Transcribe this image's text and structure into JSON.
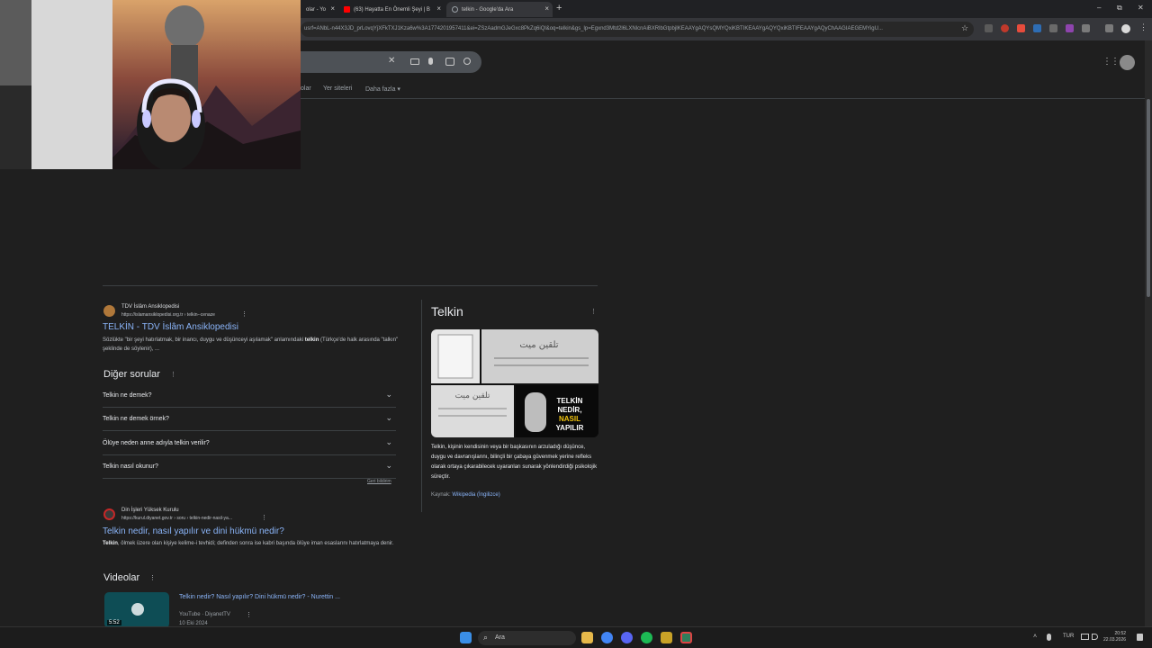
{
  "browser": {
    "tabs": [
      {
        "label": "olar - Yo",
        "favicon_color": "#888888"
      },
      {
        "label": "(63) Hayatta En Önemli Şeyi | B",
        "favicon_color": "#ff0000"
      },
      {
        "label": "telkin - Google'da Ara",
        "favicon_color": "#9aa0a6"
      }
    ],
    "new_tab": "+",
    "close_glyph": "×",
    "window_controls": {
      "minimize": "–",
      "restore": "⧉",
      "close": "✕"
    },
    "url": "usrf=ANbL-n44X3JD_prLovqYjXFkTXJ1Kza6w%3A1774201957411&ei=ZSzAadmGJeGxc8PkZq6iQl&oq=telkin&gs_lp=Egxnd3Mtd2l6LXNlcnAiBXRlbGtpbjIKEAAYgAQYsQMYQxiKBTIKEAAYgAQYQxiKBTIFEAAYgAQyChAAGIAEGEMYigU...",
    "star": "☆",
    "menu": "⋮"
  },
  "google": {
    "clear": "✕",
    "nav_tabs": {
      "partial": "olar",
      "places": "Yer siteleri",
      "more": "Daha fazla"
    },
    "more_caret": "▾",
    "apps_glyph": "⋮⋮⋮"
  },
  "results": [
    {
      "source": "TDV İslâm Ansiklopedisi",
      "url": "https://islamansiklopedisi.org.tr › telkin--cenaze",
      "title": "TELKİN - TDV İslâm Ansiklopedisi",
      "snippet_pre": "Sözlükte \"bir şeyi hatırlatmak, bir inancı, duygu ve düşünceyi aşılamak\" anlamındaki ",
      "snippet_bold": "telkin",
      "snippet_post": " (Türkçe'de halk arasında \"talkın\" şeklinde de söylenir), ...",
      "favicon_color": "#b0783a"
    },
    {
      "source": "Din İşleri Yüksek Kurulu",
      "url": "https://kurul.diyanet.gov.tr › soru › telkin-nedir-nasil-ya...",
      "title": "Telkin nedir, nasıl yapılır ve dini hükmü nedir?",
      "snippet_bold": "Telkin",
      "snippet_post": ", ölmek üzere olan kişiye kelime-i tevhidi; definden sonra ise kabri başında ölüye iman esaslarını hatırlatmaya denir.",
      "favicon_color": "#c62828"
    }
  ],
  "paa": {
    "heading": "Diğer sorular",
    "expand_glyph": "⌄",
    "questions": [
      "Telkin ne demek?",
      "Telkin ne demek örnek?",
      "Ölüye neden anne adıyla telkin verilir?",
      "Telkin nasıl okunur?"
    ],
    "feedback": "Geri bildirim"
  },
  "kp": {
    "title": "Telkin",
    "description": "Telkin, kişinin kendisinin veya bir başkasının arzuladığı düşünce, duygu ve davranışlarını, bilinçli bir çabaya güvenmek yerine refleks olarak ortaya çıkarabilecek uyaranları sunarak yönlendirdiği psikolojik süreçtir.",
    "source_label": "Kaynak: ",
    "source_link": "Wikipedia (İngilizce)",
    "image_text": "TELKİN NEDİR, NASIL YAPILIR"
  },
  "videos": {
    "heading": "Videolar",
    "items": [
      {
        "title": "Telkin nedir? Nasıl yapılır? Dini hükmü nedir? - Nurettin ...",
        "channel": "YouTube · DiyanetTV",
        "date": "10 Eki 2024",
        "duration": "5:52"
      }
    ]
  },
  "taskbar": {
    "search_placeholder": "Ara",
    "search_icon": "⌕",
    "lang": "TUR",
    "time": "20:52",
    "date": "22.03.2026"
  }
}
